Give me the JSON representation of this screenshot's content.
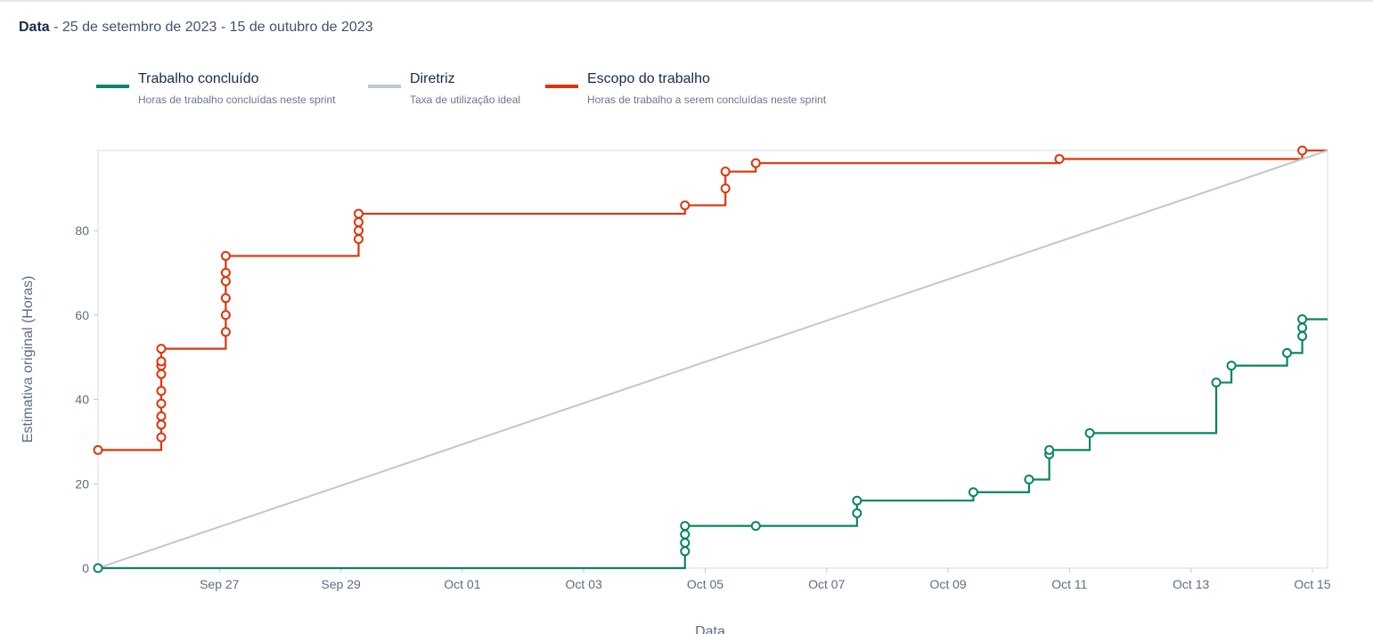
{
  "header": {
    "label": "Data",
    "range": " - 25 de setembro de 2023 - 15 de outubro de 2023"
  },
  "legend": [
    {
      "title": "Trabalho concluído",
      "subtitle": "Horas de trabalho concluídas neste sprint",
      "color": "#0a8466"
    },
    {
      "title": "Diretriz",
      "subtitle": "Taxa de utilização ideal",
      "color": "#c1c7d0"
    },
    {
      "title": "Escopo do trabalho",
      "subtitle": "Horas de trabalho a serem concluídas neste sprint",
      "color": "#de350b"
    }
  ],
  "chart_data": {
    "type": "line",
    "title": "",
    "xlabel": "Data",
    "ylabel": "Estimativa original (Horas)",
    "x_range": [
      "2023-09-25",
      "2023-10-15 06:00"
    ],
    "ylim": [
      0,
      99
    ],
    "x_ticks": [
      {
        "date": "2023-09-27",
        "label": "Sep 27"
      },
      {
        "date": "2023-09-29",
        "label": "Sep 29"
      },
      {
        "date": "2023-10-01",
        "label": "Oct 01"
      },
      {
        "date": "2023-10-03",
        "label": "Oct 03"
      },
      {
        "date": "2023-10-05",
        "label": "Oct 05"
      },
      {
        "date": "2023-10-07",
        "label": "Oct 07"
      },
      {
        "date": "2023-10-09",
        "label": "Oct 09"
      },
      {
        "date": "2023-10-11",
        "label": "Oct 11"
      },
      {
        "date": "2023-10-13",
        "label": "Oct 13"
      },
      {
        "date": "2023-10-15",
        "label": "Oct 15"
      }
    ],
    "y_ticks": [
      0,
      20,
      40,
      60,
      80
    ],
    "grid": false,
    "series": [
      {
        "name": "Escopo do trabalho",
        "step": true,
        "color": "#de350b",
        "end": "2023-10-15 06:00",
        "points": [
          {
            "x": "2023-09-25 00:00",
            "y": 28
          },
          {
            "x": "2023-09-26 01:00",
            "y": 31
          },
          {
            "x": "2023-09-26 01:00",
            "y": 34
          },
          {
            "x": "2023-09-26 01:00",
            "y": 36
          },
          {
            "x": "2023-09-26 01:00",
            "y": 39
          },
          {
            "x": "2023-09-26 01:00",
            "y": 42
          },
          {
            "x": "2023-09-26 01:00",
            "y": 46
          },
          {
            "x": "2023-09-26 01:00",
            "y": 48
          },
          {
            "x": "2023-09-26 01:00",
            "y": 49
          },
          {
            "x": "2023-09-26 01:00",
            "y": 52
          },
          {
            "x": "2023-09-27 02:30",
            "y": 56
          },
          {
            "x": "2023-09-27 02:30",
            "y": 60
          },
          {
            "x": "2023-09-27 02:30",
            "y": 64
          },
          {
            "x": "2023-09-27 02:30",
            "y": 68
          },
          {
            "x": "2023-09-27 02:30",
            "y": 70
          },
          {
            "x": "2023-09-27 02:30",
            "y": 74
          },
          {
            "x": "2023-09-29 07:00",
            "y": 78
          },
          {
            "x": "2023-09-29 07:00",
            "y": 80
          },
          {
            "x": "2023-09-29 07:00",
            "y": 82
          },
          {
            "x": "2023-09-29 07:00",
            "y": 84
          },
          {
            "x": "2023-10-04 16:00",
            "y": 86
          },
          {
            "x": "2023-10-05 08:00",
            "y": 90
          },
          {
            "x": "2023-10-05 08:00",
            "y": 94
          },
          {
            "x": "2023-10-05 20:00",
            "y": 96
          },
          {
            "x": "2023-10-10 20:00",
            "y": 97
          },
          {
            "x": "2023-10-14 20:00",
            "y": 99
          }
        ]
      },
      {
        "name": "Diretriz",
        "step": false,
        "color": "#c1c7d0",
        "points": [
          {
            "x": "2023-09-25 00:00",
            "y": 0
          },
          {
            "x": "2023-10-15 06:00",
            "y": 99
          }
        ]
      },
      {
        "name": "Trabalho concluído",
        "step": true,
        "color": "#0a8466",
        "end": "2023-10-15 06:00",
        "points": [
          {
            "x": "2023-09-25 00:00",
            "y": 0
          },
          {
            "x": "2023-10-04 16:00",
            "y": 4
          },
          {
            "x": "2023-10-04 16:00",
            "y": 6
          },
          {
            "x": "2023-10-04 16:00",
            "y": 8
          },
          {
            "x": "2023-10-04 16:00",
            "y": 10
          },
          {
            "x": "2023-10-05 20:00",
            "y": 10
          },
          {
            "x": "2023-10-07 12:00",
            "y": 13
          },
          {
            "x": "2023-10-07 12:00",
            "y": 16
          },
          {
            "x": "2023-10-09 10:00",
            "y": 18
          },
          {
            "x": "2023-10-10 08:00",
            "y": 21
          },
          {
            "x": "2023-10-10 16:00",
            "y": 27
          },
          {
            "x": "2023-10-10 16:00",
            "y": 28
          },
          {
            "x": "2023-10-11 08:00",
            "y": 32
          },
          {
            "x": "2023-10-13 10:00",
            "y": 44
          },
          {
            "x": "2023-10-13 16:00",
            "y": 48
          },
          {
            "x": "2023-10-14 14:00",
            "y": 51
          },
          {
            "x": "2023-10-14 20:00",
            "y": 55
          },
          {
            "x": "2023-10-14 20:00",
            "y": 57
          },
          {
            "x": "2023-10-14 20:00",
            "y": 59
          }
        ]
      }
    ]
  }
}
